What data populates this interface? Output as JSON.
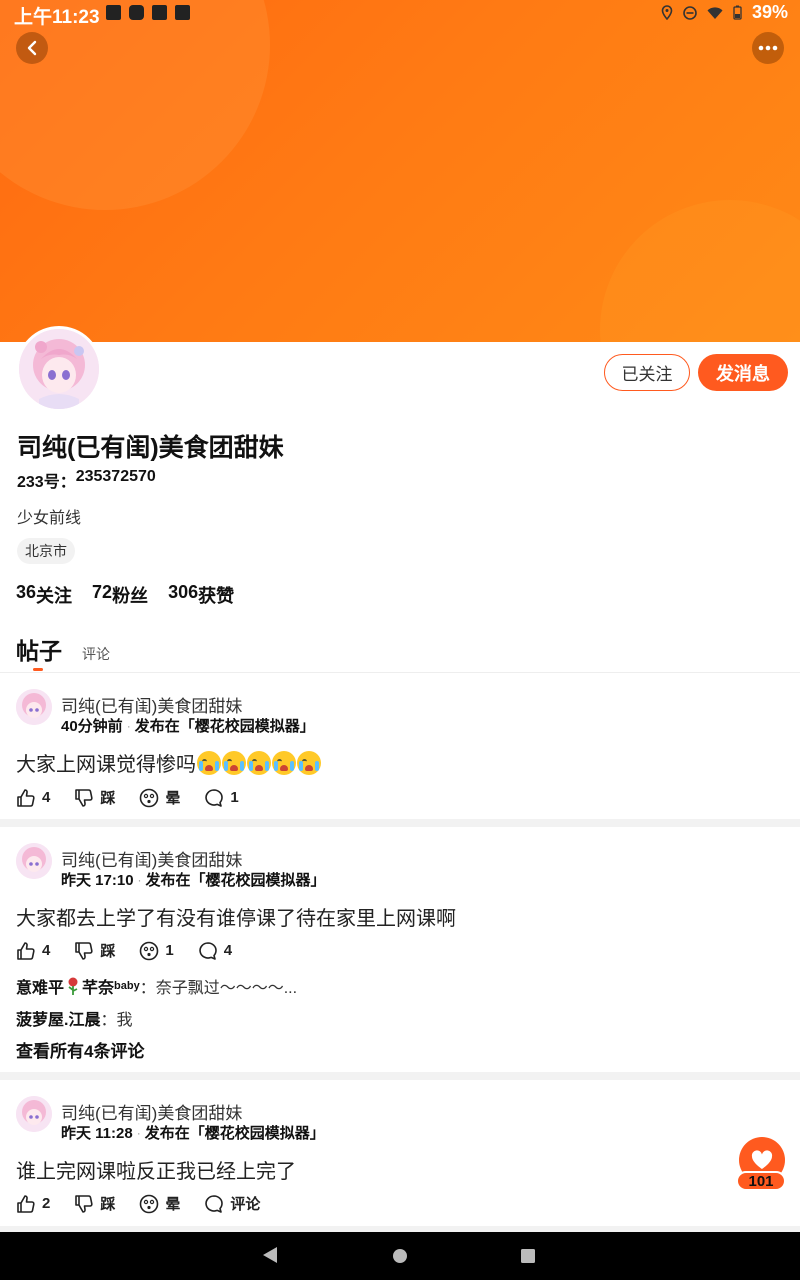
{
  "status_bar": {
    "time": "上午11:23",
    "battery": "39%"
  },
  "profile": {
    "name": "司纯(已有闺)美食团甜妹",
    "id_label": "233号：",
    "id_value": "235372570",
    "bio": "少女前线",
    "location": "北京市",
    "follow_label": "已关注",
    "message_label": "发消息",
    "stats": {
      "following": {
        "count": "36",
        "label": "关注"
      },
      "fans": {
        "count": "72",
        "label": "粉丝"
      },
      "likes": {
        "count": "306",
        "label": "获赞"
      }
    }
  },
  "tabs": {
    "posts": "帖子",
    "comments": "评论"
  },
  "posts": [
    {
      "author": "司纯(已有闺)美食团甜妹",
      "time": "40分钟前",
      "published": "发布在「樱花校园模拟器」",
      "content": "大家上网课觉得惨吗",
      "likes": "4",
      "dislike_label": "踩",
      "dizzy_label": "晕",
      "comments": "1"
    },
    {
      "author": "司纯(已有闺)美食团甜妹",
      "time": "昨天 17:10",
      "published": "发布在「樱花校园模拟器」",
      "content": "大家都去上学了有没有谁停课了待在家里上网课啊",
      "likes": "4",
      "dislike_label": "踩",
      "dizzy_count": "1",
      "comments": "4",
      "comment_previews": [
        {
          "user": "意难平",
          "user2": "芊奈",
          "sup": "baby",
          "text": "：奈子飘过～～～～..."
        },
        {
          "user": "菠萝屋.江晨",
          "text": "：我"
        }
      ],
      "view_all": "查看所有4条评论"
    },
    {
      "author": "司纯(已有闺)美食团甜妹",
      "time": "昨天 11:28",
      "published": "发布在「樱花校园模拟器」",
      "content": "谁上完网课啦反正我已经上完了",
      "likes": "2",
      "dislike_label": "踩",
      "dizzy_label": "晕",
      "comment_label": "评论"
    }
  ],
  "floating_like": {
    "count": "101"
  },
  "colors": {
    "accent": "#ff5a1f",
    "banner": "#ff7a14"
  }
}
